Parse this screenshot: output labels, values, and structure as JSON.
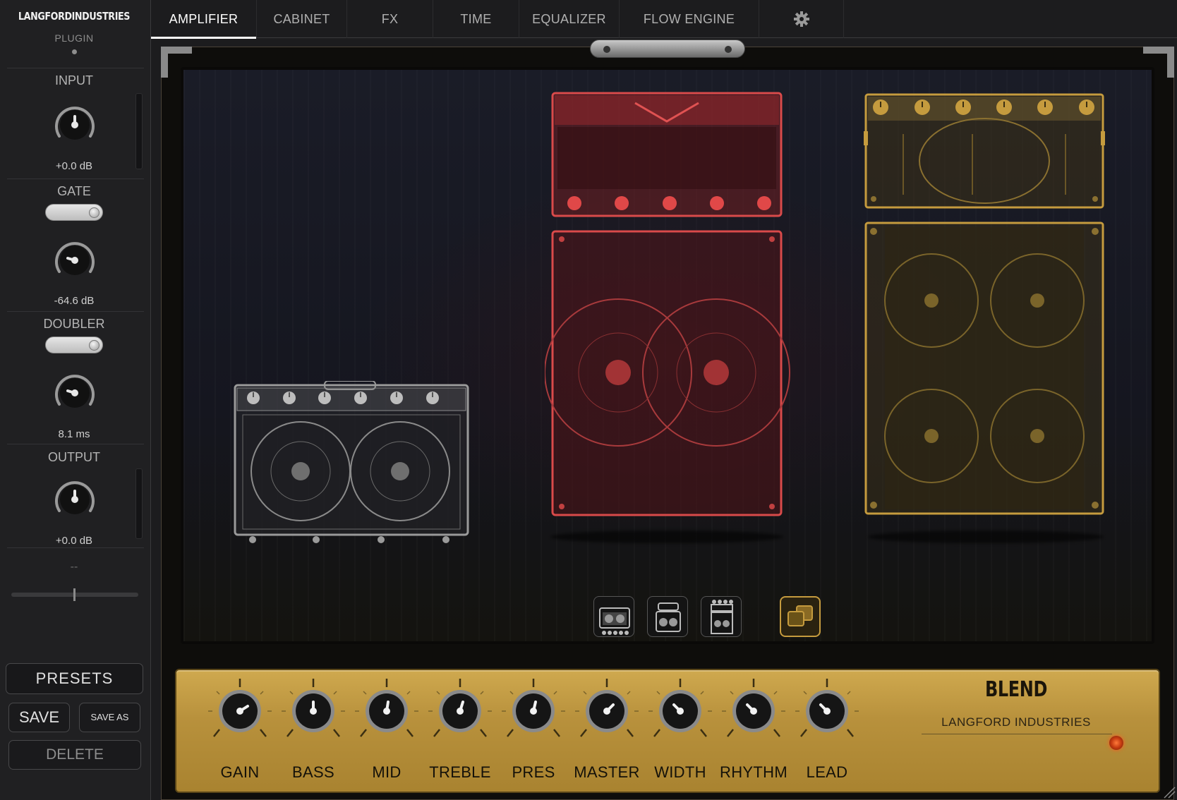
{
  "brand": {
    "name": "LANGFORDINDUSTRIES",
    "sub": "PLUGIN"
  },
  "sidebar": {
    "input": {
      "label": "INPUT",
      "value": "+0.0 dB"
    },
    "gate": {
      "label": "GATE",
      "value": "-64.6 dB"
    },
    "doubler": {
      "label": "DOUBLER",
      "value": "8.1 ms"
    },
    "output": {
      "label": "OUTPUT",
      "value": "+0.0 dB"
    },
    "dash": "--"
  },
  "buttons": {
    "presets": "PRESETS",
    "save": "SAVE",
    "save_as": "SAVE AS",
    "delete": "DELETE"
  },
  "tabs": [
    {
      "label": "AMPLIFIER"
    },
    {
      "label": "CABINET"
    },
    {
      "label": "FX"
    },
    {
      "label": "TIME"
    },
    {
      "label": "EQUALIZER"
    },
    {
      "label": "FLOW ENGINE"
    }
  ],
  "active_tab": "AMPLIFIER",
  "panel": {
    "title": "BLEND",
    "subtitle": "LANGFORD INDUSTRIES",
    "knobs": [
      {
        "label": "GAIN"
      },
      {
        "label": "BASS"
      },
      {
        "label": "MID"
      },
      {
        "label": "TREBLE"
      },
      {
        "label": "PRES"
      },
      {
        "label": "MASTER"
      },
      {
        "label": "WIDTH"
      },
      {
        "label": "RHYTHM"
      },
      {
        "label": "LEAD"
      }
    ]
  },
  "colors": {
    "accent_gold": "#c59b3e",
    "amp_red": "#d94a4a",
    "led": "#ff5a20"
  },
  "icons": [
    "settings-gear-icon",
    "amp-select-combo-icon",
    "amp-select-clean-icon",
    "amp-select-stack-icon",
    "blend-mode-icon"
  ]
}
